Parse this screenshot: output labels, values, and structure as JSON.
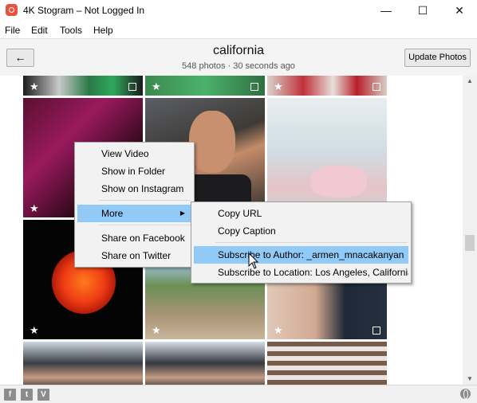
{
  "window": {
    "title": "4K Stogram – Not Logged In",
    "minimize": "—",
    "maximize": "☐",
    "close": "✕"
  },
  "menu": [
    "File",
    "Edit",
    "Tools",
    "Help"
  ],
  "header": {
    "back": "←",
    "title": "california",
    "subtitle": "548 photos · 30 seconds ago",
    "update_button": "Update Photos"
  },
  "context_menu": {
    "items": [
      "View Video",
      "Show in Folder",
      "Show on Instagram",
      "More",
      "Share on Facebook",
      "Share on Twitter"
    ],
    "highlighted": "More"
  },
  "submenu": {
    "items": [
      "Copy URL",
      "Copy Caption",
      "Subscribe to Author: _armen_mnacakanyan",
      "Subscribe to Location: Los Angeles, California"
    ],
    "highlighted": "Subscribe to Author: _armen_mnacakanyan"
  },
  "footer": {
    "social": [
      "f",
      "t",
      "V"
    ]
  },
  "icons": {
    "star": "★",
    "scroll_up": "▲",
    "scroll_down": "▼",
    "submenu_arrow": "▶"
  },
  "colors": {
    "highlight": "#91c9f7",
    "app_icon": "#e8533e"
  }
}
